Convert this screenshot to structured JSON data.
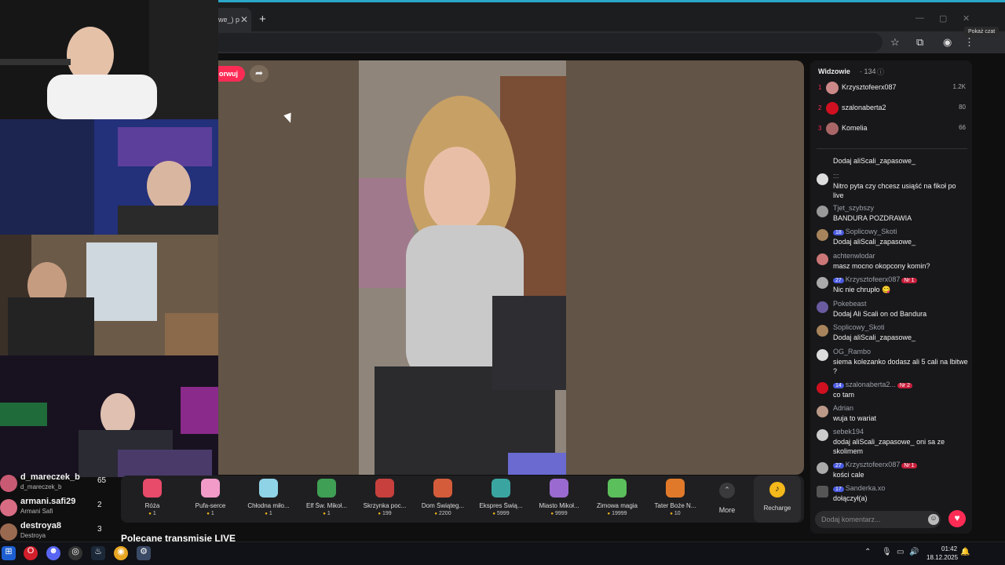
{
  "browser": {
    "tab_title": "we_) p",
    "tab_close": "✕",
    "new_tab": "+",
    "window_buttons": [
      "—",
      "▢",
      "✕"
    ],
    "tooltip": "Pokaż czat"
  },
  "stage": {
    "follow_label": "orwuj",
    "share_icon": "share-icon",
    "bg_color": "#625446",
    "accent_color": "#fe2c55"
  },
  "left_list": [
    {
      "name": "d_mareczek_b",
      "sub": "d_mareczek_b",
      "count": "65"
    },
    {
      "name": "armani.safi29",
      "sub": "Armani Safi",
      "count": "2"
    },
    {
      "name": "destroya8",
      "sub": "Destroya",
      "count": "3"
    }
  ],
  "recommended_label": "Polecane transmisje LIVE",
  "gifts": [
    {
      "name": "Róża",
      "price": "1",
      "color": "#e84a6a"
    },
    {
      "name": "Pufa-serce",
      "price": "1",
      "color": "#f29bc9"
    },
    {
      "name": "Chłodna miło...",
      "price": "1",
      "color": "#8fd3e6"
    },
    {
      "name": "Elf Św. Mikoł...",
      "price": "1",
      "color": "#3f9f54"
    },
    {
      "name": "Skrzynka poc...",
      "price": "199",
      "color": "#c7403e"
    },
    {
      "name": "Dom Świąteg...",
      "price": "2200",
      "color": "#d55c3b"
    },
    {
      "name": "Ekspres Świą...",
      "price": "5999",
      "color": "#3aa5a0"
    },
    {
      "name": "Miasto Mikoł...",
      "price": "9999",
      "color": "#9a6ad0"
    },
    {
      "name": "Zimowa magia",
      "price": "19999",
      "color": "#5bbf5b"
    },
    {
      "name": "Tater Boże N...",
      "price": "10",
      "color": "#e07a2a"
    }
  ],
  "more_label": "More",
  "recharge_label": "Recharge",
  "viewers": {
    "title": "Widzowie",
    "count": "· 134",
    "top": [
      {
        "rank": "1",
        "name": "Krzysztofeerx087",
        "score": "1.2K"
      },
      {
        "rank": "2",
        "name": "szalonaberta2",
        "score": "80"
      },
      {
        "rank": "3",
        "name": "Komelia",
        "score": "66"
      }
    ]
  },
  "chat": [
    {
      "user": "",
      "text": "Dodaj aliScali_zapasowe_"
    },
    {
      "user": ":::",
      "text": "Nitro pyta czy chcesz usiąść na fikoł po live"
    },
    {
      "user": "Tjet_szybszy",
      "text": "BANDURA POZDRAWIA"
    },
    {
      "user": "Soplicowy_Skoti",
      "level": "18",
      "text": "Dodaj aliScali_zapasowe_"
    },
    {
      "user": "achtenwlodar",
      "text": "masz mocno okopcony komin?"
    },
    {
      "user": "Krzysztofeerx087",
      "level": "27",
      "nr": "Nr 1",
      "text": "Nic nie chrupło 😋"
    },
    {
      "user": "Pokebeast",
      "text": "Dodaj Ali Scali on od Bandura"
    },
    {
      "user": "Soplicowy_Skoti",
      "text": "Dodaj aliScali_zapasowe_"
    },
    {
      "user": "OG_Rambo",
      "text": "siema kolezanko dodasz ali 5 cali na lbitwe ?"
    },
    {
      "user": "szalonaberta2...",
      "level": "14",
      "nr": "Nr 2",
      "text": "co tam"
    },
    {
      "user": "Adrian",
      "text": "wuja to wariat"
    },
    {
      "user": "sebek194",
      "text": "dodaj aliScali_zapasowe_ oni sa ze skolimem"
    },
    {
      "user": "Krzysztofeerx087",
      "level": "27",
      "nr": "Nr 1",
      "text": "kości cale"
    },
    {
      "user": "Sanderka.xo",
      "level": "17",
      "text": "dołączył(a)"
    }
  ],
  "comment_placeholder": "Dodaj komentarz...",
  "taskbar": {
    "time": "01:42",
    "date": "18.12.2025"
  }
}
